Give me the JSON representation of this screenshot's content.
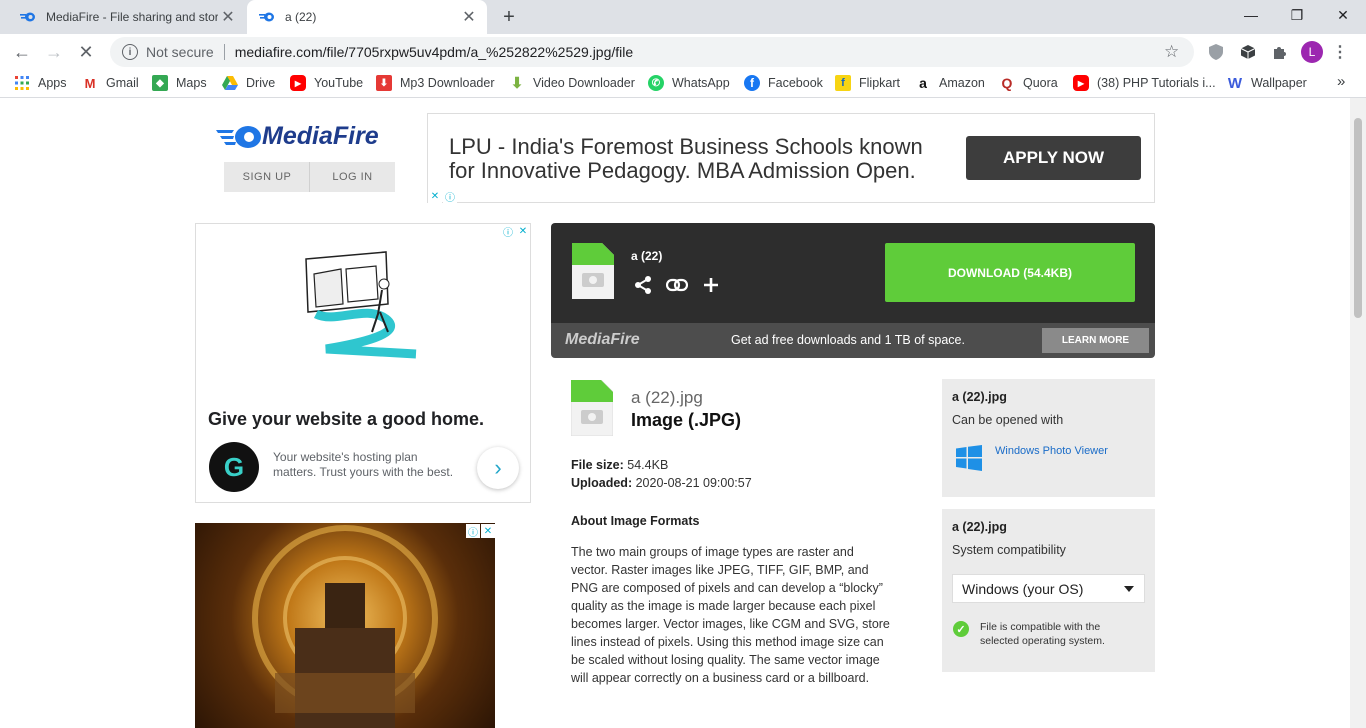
{
  "browser": {
    "tabs": [
      {
        "title": "MediaFire - File sharing and stora",
        "close": "✕"
      },
      {
        "title": "a (22)",
        "close": "✕"
      }
    ],
    "new_tab": "+",
    "window": {
      "minimize": "—",
      "maximize": "❐",
      "close": "✕"
    },
    "nav": {
      "back": "←",
      "forward": "→",
      "stop": "✕"
    },
    "omnibox": {
      "security_icon": "i",
      "security": "Not secure",
      "url": "mediafire.com/file/7705rxpw5uv4pdm/a_%252822%2529.jpg/file",
      "star": "☆"
    },
    "profile_initial": "L",
    "bookmarks": [
      {
        "label": "Apps",
        "icon": "apps-icon",
        "color": "#1a73e8"
      },
      {
        "label": "Gmail",
        "icon": "gmail-icon",
        "color": "#d93025"
      },
      {
        "label": "Maps",
        "icon": "maps-icon",
        "color": "#34a853"
      },
      {
        "label": "Drive",
        "icon": "drive-icon",
        "color": "#fbbc04"
      },
      {
        "label": "YouTube",
        "icon": "youtube-icon",
        "color": "#ff0000"
      },
      {
        "label": "Mp3 Downloader",
        "icon": "download-icon",
        "color": "#e53935"
      },
      {
        "label": "Video Downloader",
        "icon": "download-arrow-icon",
        "color": "#7cb342"
      },
      {
        "label": "WhatsApp",
        "icon": "whatsapp-icon",
        "color": "#25d366"
      },
      {
        "label": "Facebook",
        "icon": "facebook-icon",
        "color": "#1877f2"
      },
      {
        "label": "Flipkart",
        "icon": "flipkart-icon",
        "color": "#f7d413"
      },
      {
        "label": "Amazon",
        "icon": "amazon-icon",
        "color": "#111111"
      },
      {
        "label": "Quora",
        "icon": "quora-icon",
        "color": "#b92b27"
      },
      {
        "label": "(38) PHP Tutorials i...",
        "icon": "youtube-icon",
        "color": "#ff0000"
      },
      {
        "label": "Wallpaper",
        "icon": "wallpaper-icon",
        "color": "#3b5bdb"
      }
    ],
    "bookmarks_overflow": "»"
  },
  "site": {
    "logo": "MediaFire",
    "signup": "SIGN UP",
    "login": "LOG IN"
  },
  "top_ad": {
    "text": "LPU - India's Foremost Business Schools known for Innovative Pedagogy. MBA Admission Open.",
    "cta": "APPLY NOW"
  },
  "left_ad": {
    "headline": "Give your website a good home.",
    "body": "Your website's hosting plan matters. Trust yours with the best.",
    "arrow": "›"
  },
  "download": {
    "filename": "a (22)",
    "button": "DOWNLOAD (54.4KB)",
    "share": "⋖",
    "link": "⊂⊃",
    "add": "+"
  },
  "promo": {
    "logo": "MediaFire",
    "text": "Get ad free downloads and 1 TB of space.",
    "button": "LEARN MORE"
  },
  "file": {
    "name": "a (22).jpg",
    "type": "Image (.JPG)",
    "size_label": "File size:",
    "size": "54.4KB",
    "uploaded_label": "Uploaded:",
    "uploaded": "2020-08-21 09:00:57",
    "about_title": "About Image Formats",
    "about_text": "The two main groups of image types are raster and vector. Raster images like JPEG, TIFF, GIF, BMP, and PNG are composed of pixels and can develop a “blocky” quality as the image is made larger because each pixel becomes larger. Vector images, like CGM and SVG, store lines instead of pixels. Using this method image size can be scaled without losing quality. The same vector image will appear correctly on a business card or a billboard."
  },
  "open_with": {
    "title": "a (22).jpg",
    "subtitle": "Can be opened with",
    "app": "Windows Photo Viewer"
  },
  "compatibility": {
    "title": "a (22).jpg",
    "subtitle": "System compatibility",
    "os": "Windows (your OS)",
    "check": "✓",
    "message": "File is compatible with the selected operating system."
  },
  "colors": {
    "download_green": "#5fcc3a",
    "mediafire_blue": "#1e3c8c",
    "link_blue": "#1a6cc8"
  }
}
